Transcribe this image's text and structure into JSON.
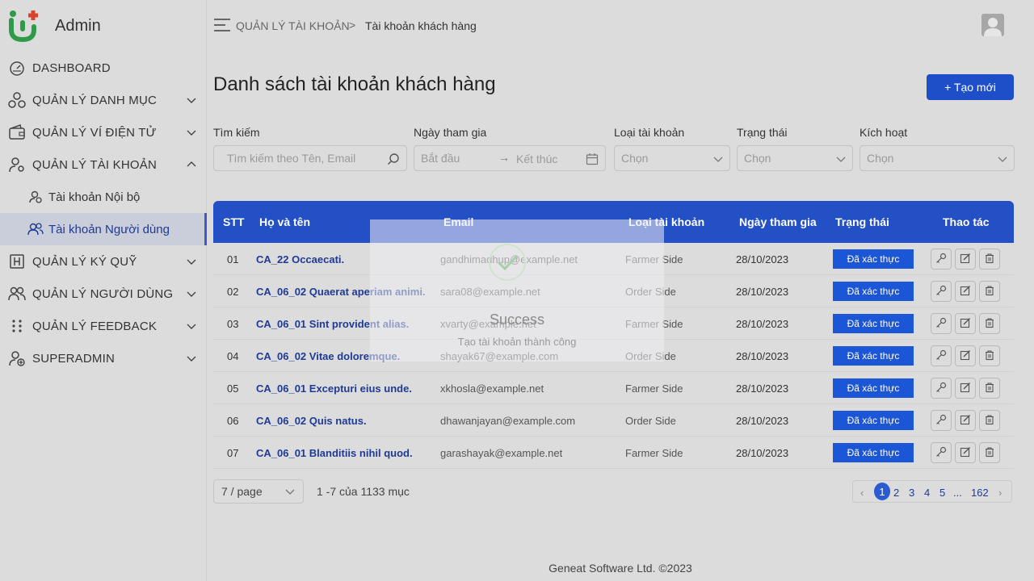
{
  "app": {
    "title": "Admin"
  },
  "sidebar": {
    "items": [
      {
        "label": "DASHBOARD",
        "icon": "dashboard-icon"
      },
      {
        "label": "QUẢN LÝ DANH MỤC",
        "icon": "category-icon"
      },
      {
        "label": "QUẢN LÝ VÍ ĐIỆN TỬ",
        "icon": "wallet-icon"
      },
      {
        "label": "QUẢN LÝ TÀI KHOẢN",
        "icon": "user-gear-icon"
      },
      {
        "label": "QUẢN LÝ KÝ QUỸ",
        "icon": "deposit-icon"
      },
      {
        "label": "QUẢN LÝ NGƯỜI DÙNG",
        "icon": "users-icon"
      },
      {
        "label": "QUẢN LÝ FEEDBACK",
        "icon": "drag-dots-icon"
      },
      {
        "label": "SUPERADMIN",
        "icon": "user-add-icon"
      }
    ],
    "subitems": [
      {
        "label": "Tài khoản Nội bộ"
      },
      {
        "label": "Tài khoản Người dùng"
      }
    ]
  },
  "header": {
    "breadcrumb_parent": "QUẢN LÝ TÀI KHOẢN",
    "breadcrumb_sep": ">",
    "breadcrumb_current": "Tài khoản khách hàng"
  },
  "page": {
    "title": "Danh sách tài khoản khách hàng",
    "create_label": "+ Tạo mới"
  },
  "filters": {
    "search_label": "Tìm kiếm",
    "search_placeholder": "Tìm kiếm theo Tên, Email",
    "date_label": "Ngày tham gia",
    "date_start": "Bắt đầu",
    "date_end": "Kết thúc",
    "type_label": "Loại tài khoản",
    "type_value": "Chọn",
    "status_label": "Trạng thái",
    "status_value": "Chọn",
    "active_label": "Kích hoạt",
    "active_value": "Chọn"
  },
  "table": {
    "headers": [
      "STT",
      "Họ và tên",
      "Email",
      "Loại tài khoản",
      "Ngày tham gia",
      "Trạng thái",
      "Thao tác"
    ],
    "rows": [
      {
        "stt": "01",
        "name": "CA_22 Occaecati.",
        "email": "gandhimadhup@example.net",
        "type": "Farmer Side",
        "date": "28/10/2023",
        "status": "Đã xác thực"
      },
      {
        "stt": "02",
        "name": "CA_06_02 Quaerat aperiam animi.",
        "email": "sara08@example.net",
        "type": "Order Side",
        "date": "28/10/2023",
        "status": "Đã xác thực"
      },
      {
        "stt": "03",
        "name": "CA_06_01 Sint provident alias.",
        "email": "xvarty@example.net",
        "type": "Farmer Side",
        "date": "28/10/2023",
        "status": "Đã xác thực"
      },
      {
        "stt": "04",
        "name": "CA_06_02 Vitae doloremque.",
        "email": "shayak67@example.com",
        "type": "Order Side",
        "date": "28/10/2023",
        "status": "Đã xác thực"
      },
      {
        "stt": "05",
        "name": "CA_06_01 Excepturi eius unde.",
        "email": "xkhosla@example.net",
        "type": "Farmer Side",
        "date": "28/10/2023",
        "status": "Đã xác thực"
      },
      {
        "stt": "06",
        "name": "CA_06_02 Quis natus.",
        "email": "dhawanjayan@example.com",
        "type": "Order Side",
        "date": "28/10/2023",
        "status": "Đã xác thực"
      },
      {
        "stt": "07",
        "name": "CA_06_01 Blanditiis nihil quod.",
        "email": "garashayak@example.net",
        "type": "Farmer Side",
        "date": "28/10/2023",
        "status": "Đã xác thực"
      }
    ]
  },
  "pagination": {
    "page_size": "7 / page",
    "total": "1 -7 của 1133 mục",
    "pages": [
      "1",
      "2",
      "3",
      "4",
      "5",
      "...",
      "162"
    ],
    "current": "1"
  },
  "footer": {
    "text": "Geneat Software Ltd. ©2023"
  },
  "toast": {
    "title": "Success",
    "message": "Tạo tài khoản thành công"
  },
  "colors": {
    "primary": "#2450c6",
    "badge": "#1a56d6",
    "link": "#1f3a93",
    "logo_green": "#2e9b4a",
    "logo_red": "#d9432b"
  }
}
